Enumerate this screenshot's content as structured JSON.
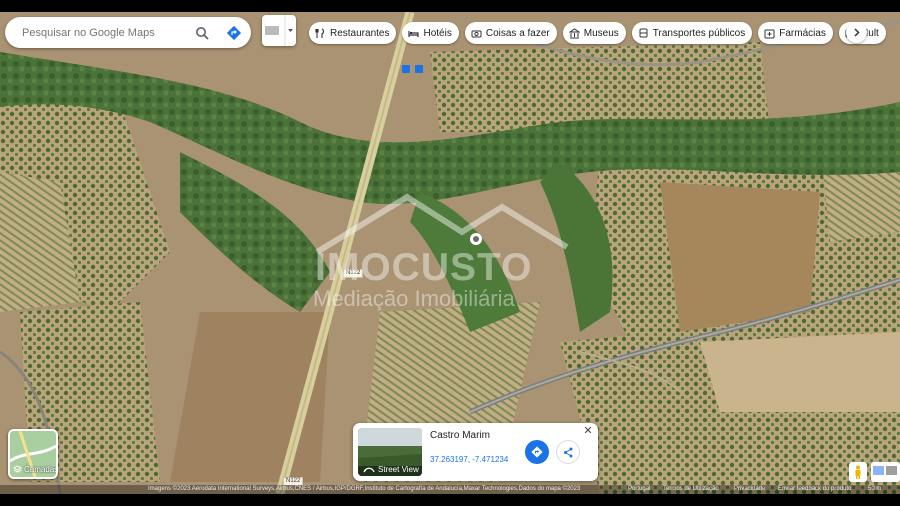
{
  "search": {
    "placeholder": "Pesquisar no Google Maps"
  },
  "chips": [
    {
      "icon": "fork-knife-icon",
      "label": "Restaurantes"
    },
    {
      "icon": "bed-icon",
      "label": "Hotéis"
    },
    {
      "icon": "camera-icon",
      "label": "Coisas a fazer"
    },
    {
      "icon": "museum-icon",
      "label": "Museus"
    },
    {
      "icon": "bus-icon",
      "label": "Transportes públicos"
    },
    {
      "icon": "pharmacy-icon",
      "label": "Farmácias"
    },
    {
      "icon": "atm-icon",
      "label": "Mult"
    }
  ],
  "watermark": {
    "brand": "IMOCUSTO",
    "tagline": "Mediação Imobiliária"
  },
  "road_labels": [
    "N122",
    "N122"
  ],
  "place_card": {
    "title": "Castro Marim",
    "coords": "37.263197, -7.471234",
    "street_view": "Street View"
  },
  "layers": {
    "label": "Camadas"
  },
  "footer": {
    "attribution": "Imagens ©2023 Aerodata International Surveys,Airbus,CNES / Airbus,IGP/DGRF,Instituto de Cartografía de Andalucía,Maxar Technologies,Dados do mapa ©2023",
    "country": "Portugal",
    "terms": "Termos de Utilização",
    "privacy": "Privacidade",
    "feedback": "Enviar feedback do produto",
    "scale": "50 m"
  },
  "colors": {
    "accent": "#1a73e8",
    "vegetation": "#3f6b34",
    "field": "#b5a07a"
  }
}
